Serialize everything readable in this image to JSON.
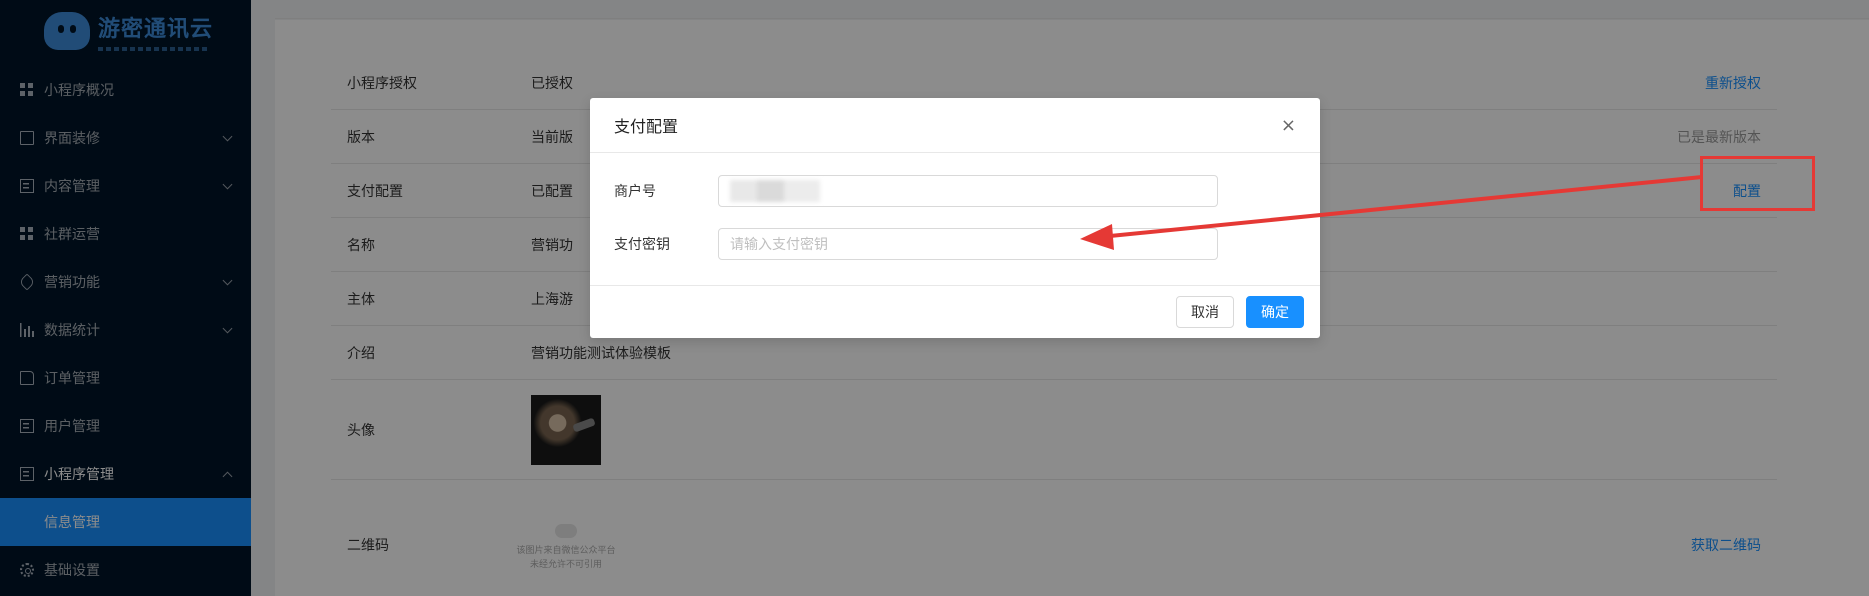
{
  "brand": {
    "name": "游密通讯云"
  },
  "sidebar": {
    "items": [
      {
        "label": "小程序概况"
      },
      {
        "label": "界面装修"
      },
      {
        "label": "内容管理"
      },
      {
        "label": "社群运营"
      },
      {
        "label": "营销功能"
      },
      {
        "label": "数据统计"
      },
      {
        "label": "订单管理"
      },
      {
        "label": "用户管理"
      },
      {
        "label": "小程序管理"
      },
      {
        "label": "信息管理"
      },
      {
        "label": "基础设置"
      }
    ]
  },
  "info_rows": [
    {
      "key": "小程序授权",
      "value": "已授权",
      "action": "重新授权"
    },
    {
      "key": "版本",
      "value": "当前版",
      "action": "已是最新版本"
    },
    {
      "key": "支付配置",
      "value": "已配置",
      "action": "配置"
    },
    {
      "key": "名称",
      "value": "营销功"
    },
    {
      "key": "主体",
      "value": "上海游"
    },
    {
      "key": "介绍",
      "value": "营销功能测试体验模板"
    },
    {
      "key": "头像"
    },
    {
      "key": "二维码",
      "qr_placeholder_line1": "该图片来自微信公众平台",
      "qr_placeholder_line2": "未经允许不可引用",
      "action": "获取二维码"
    }
  ],
  "modal": {
    "title": "支付配置",
    "close_glyph": "×",
    "merchant_label": "商户号",
    "merchant_value": "",
    "key_label": "支付密钥",
    "key_placeholder": "请输入支付密钥",
    "cancel_label": "取消",
    "ok_label": "确定"
  },
  "colors": {
    "primary": "#1890ff",
    "sidebar_bg": "#001529",
    "annotation": "#e53935"
  }
}
